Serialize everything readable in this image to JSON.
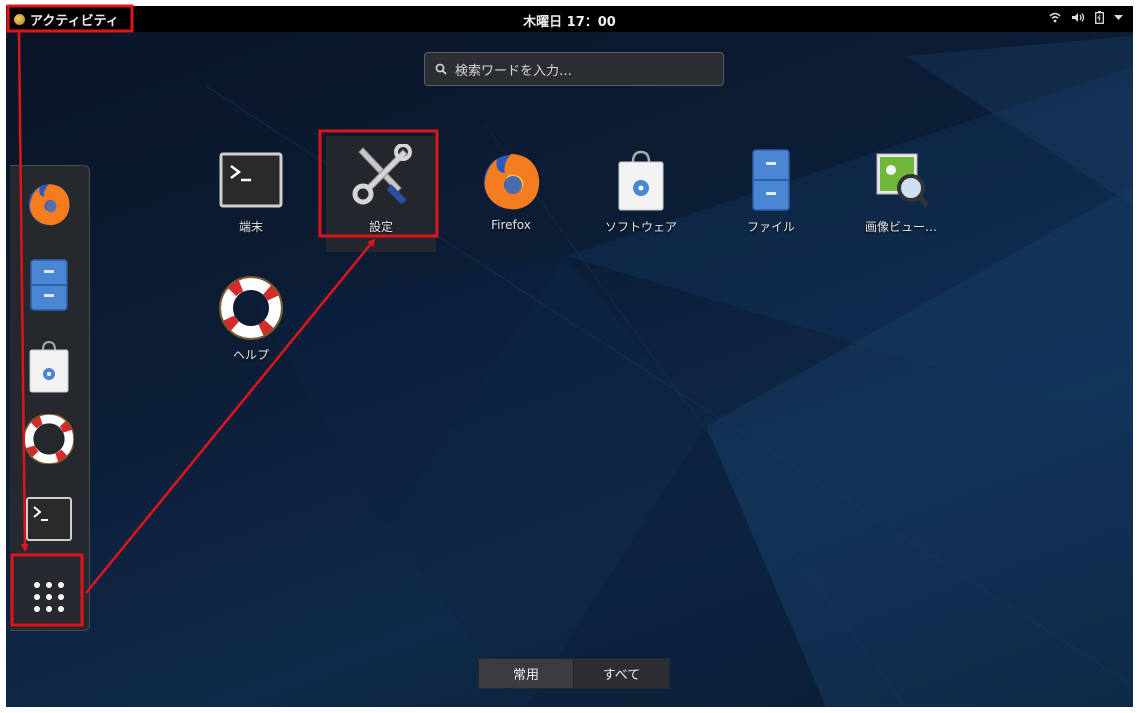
{
  "topbar": {
    "activities_label": "アクティビティ",
    "clock": "木曜日 17：00",
    "tray": [
      "wifi-icon",
      "volume-icon",
      "battery-icon",
      "dropdown-arrow-icon"
    ]
  },
  "search": {
    "placeholder": "検索ワードを入力…"
  },
  "dash": {
    "items": [
      {
        "icon": "firefox-icon"
      },
      {
        "icon": "file-manager-icon"
      },
      {
        "icon": "software-icon"
      },
      {
        "icon": "help-icon"
      },
      {
        "icon": "terminal-icon"
      },
      {
        "icon": "show-applications-icon"
      }
    ]
  },
  "apps": {
    "items": [
      {
        "label": "端末",
        "icon": "terminal-icon"
      },
      {
        "label": "設定",
        "icon": "settings-icon"
      },
      {
        "label": "Firefox",
        "icon": "firefox-icon"
      },
      {
        "label": "ソフトウェア",
        "icon": "software-icon"
      },
      {
        "label": "ファイル",
        "icon": "file-manager-icon"
      },
      {
        "label": "画像ビュー…",
        "icon": "image-viewer-icon"
      },
      {
        "label": "ヘルプ",
        "icon": "help-icon"
      }
    ]
  },
  "tabs": {
    "frequent": "常用",
    "all": "すべて"
  },
  "colors": {
    "annotation_red": "#e0141b",
    "topbar": "#000000",
    "desktop": "#0c1d36"
  }
}
